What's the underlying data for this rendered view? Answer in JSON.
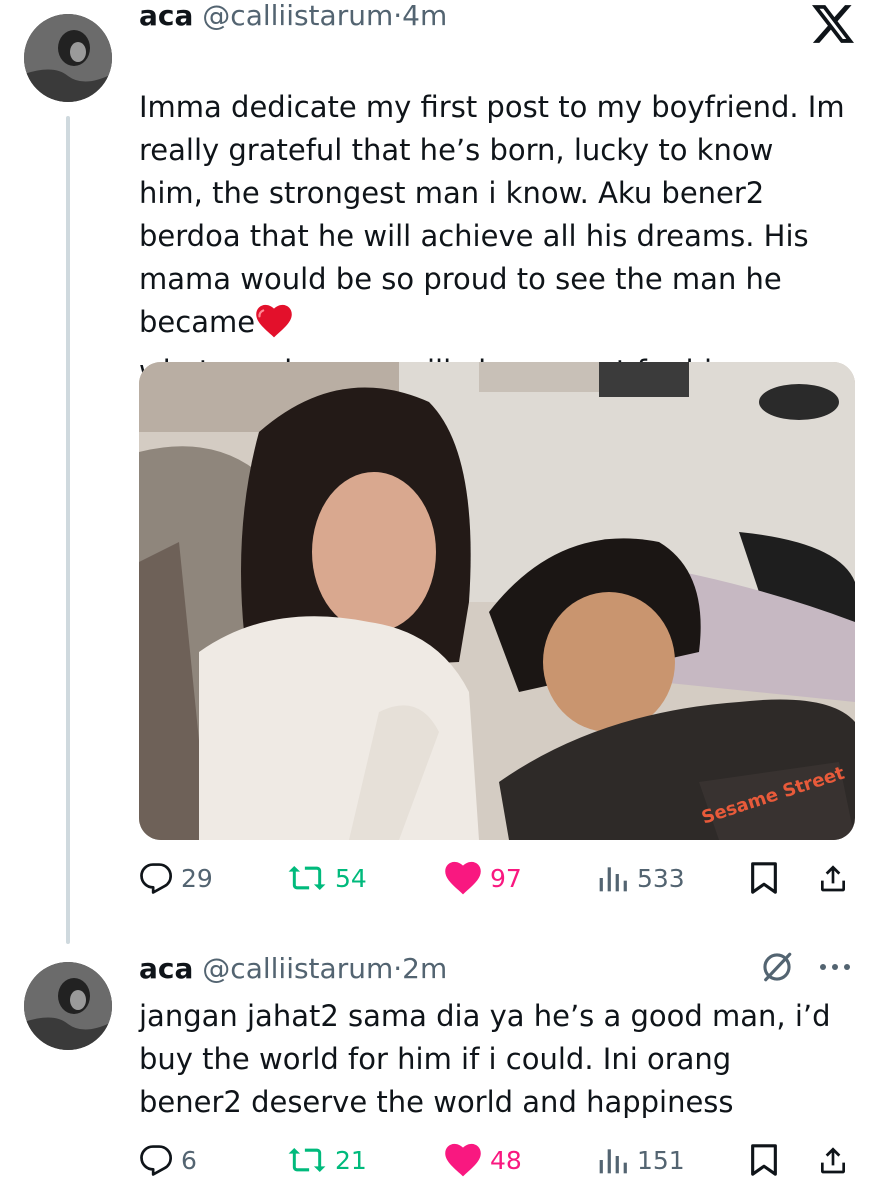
{
  "posts": [
    {
      "name": "aca",
      "handle": "@calliistarum",
      "separator": "·",
      "time": "4m",
      "text_before_emoji": "Imma dedicate my first post to my boyfriend. Im\nreally grateful that he’s born, lucky to know\nhim, the strongest man i know. Aku bener2\nberdoa that he will achieve all his dreams. His\nmama would be so proud to see the man he\nbecame",
      "emoji": "red-heart",
      "text_after_emoji": "whatever happens, ill always root for him.",
      "metrics": {
        "replies": "29",
        "reposts": "54",
        "likes": "97",
        "views": "533"
      }
    },
    {
      "name": "aca",
      "handle": "@calliistarum",
      "separator": "·",
      "time": "2m",
      "text": "jangan jahat2 sama dia ya he’s a good man, i’d\nbuy the world for him if i could. Ini orang\nbener2 deserve the world and happiness",
      "metrics": {
        "replies": "6",
        "reposts": "21",
        "likes": "48",
        "views": "151"
      }
    }
  ],
  "colors": {
    "text": "#0f1419",
    "secondary": "#536471",
    "repost_active": "#00ba7c",
    "like_active": "#f91880",
    "thread_line": "#cfd9de"
  },
  "icons": [
    "x-logo",
    "reply-icon",
    "repost-icon",
    "like-icon",
    "views-icon",
    "bookmark-icon",
    "share-icon",
    "edit-icon",
    "more-icon"
  ]
}
